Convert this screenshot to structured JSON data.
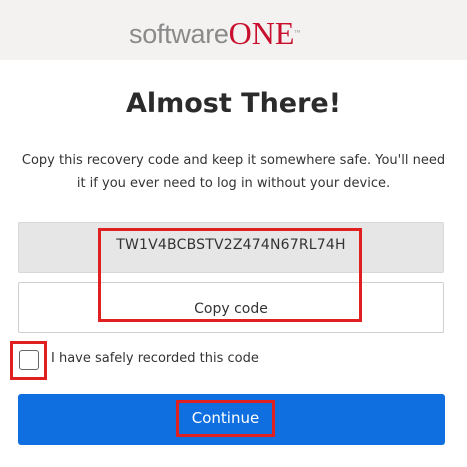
{
  "header": {
    "logo": {
      "text_soft": "software",
      "text_one": "ONE",
      "trademark": "™"
    }
  },
  "main": {
    "title": "Almost There!",
    "description": "Copy this recovery code and keep it somewhere safe. You'll need it if you ever need to log in without your device.",
    "recovery_code": "TW1V4BCBSTV2Z474N67RL74H",
    "copy_button_label": "Copy code",
    "checkbox": {
      "label": "I have safely recorded this code",
      "checked": false
    },
    "continue_button_label": "Continue"
  },
  "colors": {
    "brand_red": "#c8102e",
    "primary_blue": "#0f6fe0",
    "highlight_red": "#e02020",
    "header_bg": "#f3f2f1",
    "code_bg": "#e6e6e6"
  }
}
